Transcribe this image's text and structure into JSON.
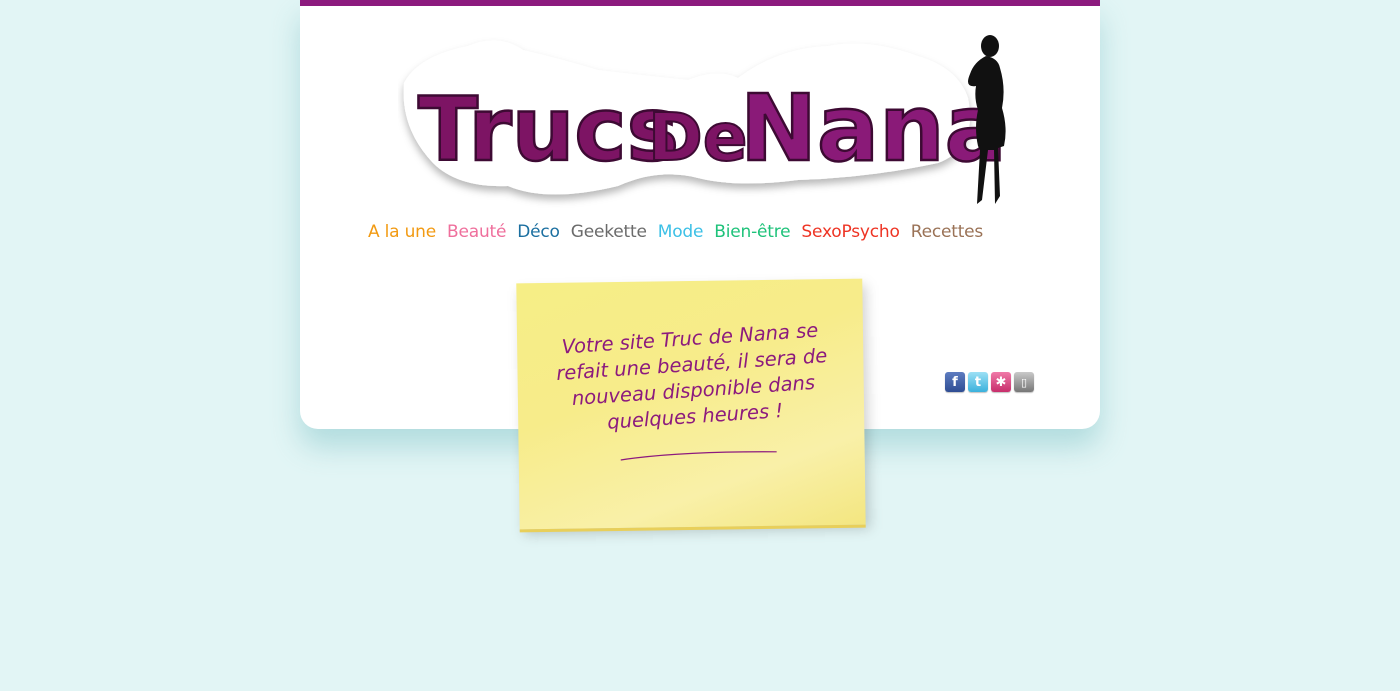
{
  "logo": {
    "part1": "Trucs",
    "part2": "De",
    "part3": "Nana"
  },
  "nav": {
    "items": [
      {
        "label": "A la une",
        "color": "#f29a12"
      },
      {
        "label": "Beauté",
        "color": "#ef6f9c"
      },
      {
        "label": "Déco",
        "color": "#1b6fa0"
      },
      {
        "label": "Geekette",
        "color": "#6b6b6b"
      },
      {
        "label": "Mode",
        "color": "#3cc0e6"
      },
      {
        "label": "Bien-être",
        "color": "#1ec27a"
      },
      {
        "label": "SexoPsycho",
        "color": "#ee3424"
      },
      {
        "label": "Recettes",
        "color": "#9a7256"
      }
    ]
  },
  "note": {
    "message": "Votre site Truc de Nana se refait une beauté, il sera de nouveau disponible dans quelques heures !"
  },
  "social": {
    "icons": [
      "facebook-icon",
      "twitter-icon",
      "netvibes-icon",
      "mobile-icon"
    ]
  },
  "colors": {
    "accent": "#8c1a7e",
    "background": "#e2f5f5"
  }
}
